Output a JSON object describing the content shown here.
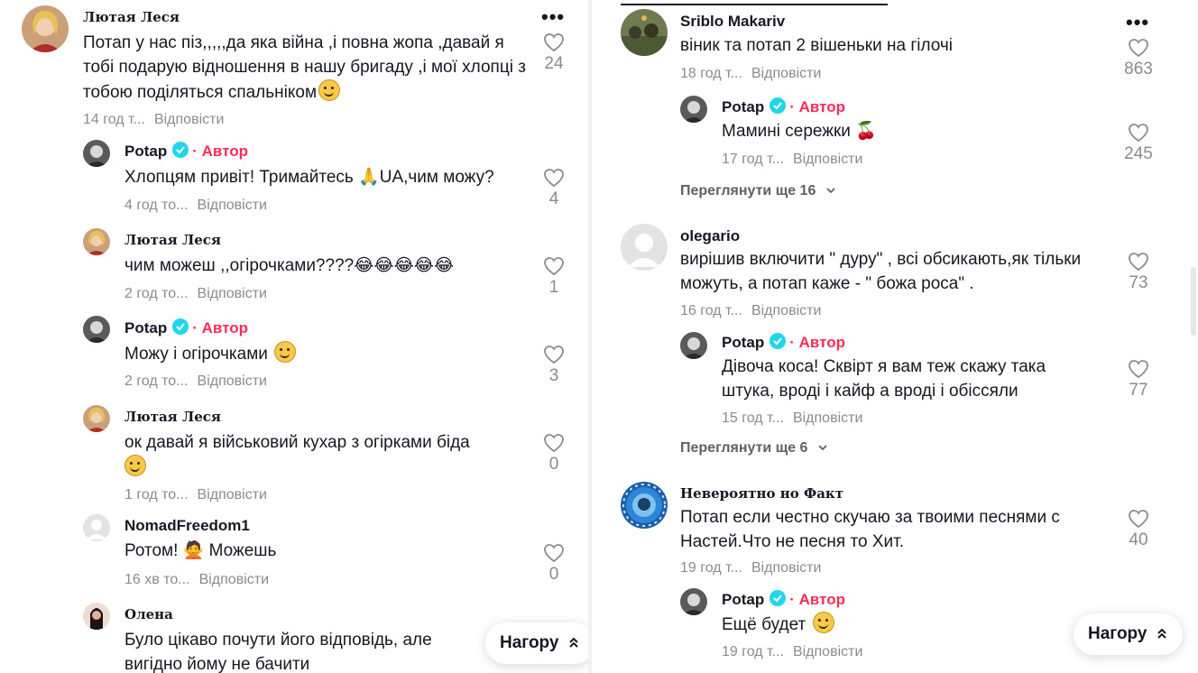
{
  "common": {
    "reply_label": "Відповісти",
    "author_label": "· Автор",
    "more_icon": "•••",
    "to_top_label": "Нагору"
  },
  "left": {
    "c1": {
      "name": "Лютая Леся",
      "text": "Потап у нас піз,,,,,да яка війна ,і повна жопа ,давай я тобі подарую відношення в нашу бригаду ,і мої хлопці з тобою поділяться спальніком",
      "time": "14 год т...",
      "likes": "24"
    },
    "r1": {
      "name": "Potap",
      "text": "Хлопцям привіт! Тримайтесь 🙏UA,чим можу?",
      "time": "4 год то...",
      "likes": "4"
    },
    "r2": {
      "name": "Лютая Леся",
      "text": "чим можеш ,,огірочками????😂😂😂😂😂",
      "time": "2 год то...",
      "likes": "1"
    },
    "r3": {
      "name": "Potap",
      "text": "Можу і огірочками",
      "time": "2 год то...",
      "likes": "3"
    },
    "r4": {
      "name": "Лютая Леся",
      "text": "ок давай я військовий кухар з огірками біда",
      "time": "1 год то...",
      "likes": "0"
    },
    "r5": {
      "name": "NomadFreedom1",
      "text": "Ротом! 🙅 Можешь",
      "time": "16 хв то...",
      "likes": "0"
    },
    "r6": {
      "name": "Олена",
      "text": "Було цікаво почути його відповідь, але вигідно йому не бачити"
    }
  },
  "right": {
    "c1": {
      "name": "Sriblo Makariv",
      "text": "віник та потап 2 вішеньки на гілочі",
      "time": "18 год т...",
      "likes": "863"
    },
    "c1r1": {
      "name": "Potap",
      "text": "Мамині сережки 🍒",
      "time": "17 год т...",
      "likes": "245"
    },
    "c1_more": "Переглянути ще 16",
    "c2": {
      "name": "olegario",
      "text": "вирішив включити \" дуру\" , всі обсикають,як тільки можуть, а потап каже - \" божа роса\" .",
      "time": "16 год т...",
      "likes": "73"
    },
    "c2r1": {
      "name": "Potap",
      "text": "Дівоча коса! Сквірт я вам теж скажу така штука, вроді і кайф а вроді і обіссяли",
      "time": "15 год т...",
      "likes": "77"
    },
    "c2_more": "Переглянути ще 6",
    "c3": {
      "name": "Невероятно но Факт",
      "text": "Потап если честно скучаю за твоими песнями с Настей.Что не песня то Хит.",
      "time": "19 год т...",
      "likes": "40"
    },
    "c3r1": {
      "name": "Potap",
      "text": "Ещё будет",
      "time": "19 год т..."
    }
  },
  "colors": {
    "accent": "#fe2c55",
    "verified": "#20d5ec",
    "muted": "#8a8b91"
  }
}
